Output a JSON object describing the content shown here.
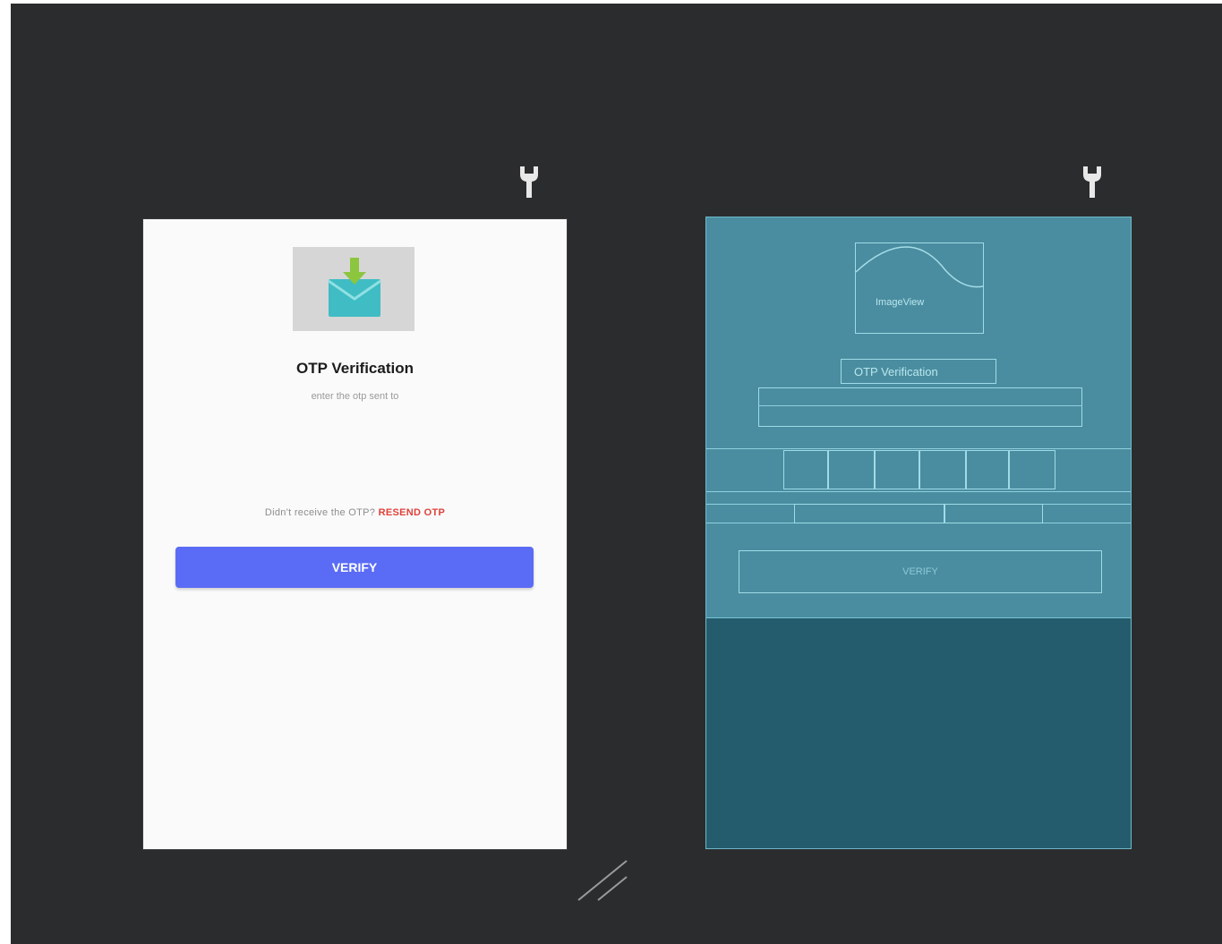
{
  "design": {
    "title": "OTP Verification",
    "subtitle": "enter the otp sent to",
    "resend_prefix": "Didn't receive the OTP?",
    "resend_link": "RESEND OTP",
    "verify_label": "VERIFY"
  },
  "blueprint": {
    "image_label": "ImageView",
    "title": "OTP Verification",
    "verify_label": "VERIFY"
  },
  "icons": {
    "left_wrench": "wrench-icon",
    "right_wrench": "wrench-icon",
    "image": "mail-download-icon",
    "resize": "resize-handle-icon"
  },
  "colors": {
    "canvas": "#2b2c2e",
    "button": "#5a6cf5",
    "resend_link": "#e0413a",
    "blueprint": "#245c6d",
    "blueprint_top": "#4a8da0"
  }
}
